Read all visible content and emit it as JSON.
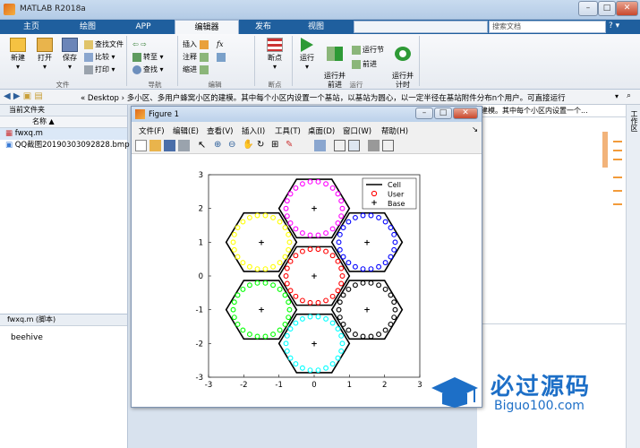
{
  "app": {
    "title": "MATLAB R2018a"
  },
  "tabs": [
    "主页",
    "绘图",
    "APP",
    "编辑器",
    "发布",
    "视图"
  ],
  "active_tab": "编辑器",
  "search": {
    "placeholder": "搜索文档"
  },
  "ribbon": {
    "file": {
      "new": "新建",
      "open": "打开",
      "save": "保存",
      "find_files": "查找文件",
      "compare": "比较",
      "print": "打印",
      "group": "文件"
    },
    "nav": {
      "goto": "转至",
      "find": "查找",
      "group": "导航"
    },
    "edit": {
      "insert": "插入",
      "comment": "注释",
      "indent": "缩进",
      "fx": "fx",
      "group": "编辑"
    },
    "breakpoints": {
      "label": "断点",
      "group": "断点"
    },
    "run": {
      "run": "运行",
      "run_advance": "运行并\n前进",
      "run_section": "运行节",
      "advance": "前进",
      "run_time": "运行并\n计时",
      "group": "运行"
    }
  },
  "address": {
    "path": "« Desktop › 多小区、多用户蜂窝小区的建模。其中每个小区内设置一个基站，以基站为圆心，以一定半径在基站附件分布n个用户。可直接运行"
  },
  "left_panel": {
    "header": "当前文件夹",
    "column": "名称 ▲",
    "files": [
      "fwxq.m",
      "QQ截图20190303092828.bmp"
    ],
    "detail_title": "fwxq.m  (脚本)",
    "detail_text": "beehive"
  },
  "right_panel": {
    "text": "建模。其中每个小区内设置一个...",
    "side_label": "工作区"
  },
  "figure": {
    "title": "Figure 1",
    "menu": [
      "文件(F)",
      "编辑(E)",
      "查看(V)",
      "插入(I)",
      "工具(T)",
      "桌面(D)",
      "窗口(W)",
      "帮助(H)"
    ]
  },
  "watermark": {
    "brand": "必过源码",
    "url": "Biguo100.com"
  },
  "chart_data": {
    "type": "scatter",
    "xlim": [
      -3,
      3
    ],
    "ylim": [
      -3,
      3
    ],
    "x_ticks": [
      -3,
      -2,
      -1,
      0,
      1,
      2,
      3
    ],
    "y_ticks": [
      -3,
      -2,
      -1,
      0,
      1,
      2,
      3
    ],
    "grid": false,
    "legend": {
      "placement": "top-right",
      "entries": [
        "Cell",
        "User",
        "Base"
      ]
    },
    "cell_radius": 1,
    "user_radius": 0.8,
    "cells": [
      {
        "center": [
          0,
          0
        ],
        "color": "#ff0000"
      },
      {
        "center": [
          0,
          2
        ],
        "color": "#ff00ff"
      },
      {
        "center": [
          1.5,
          1
        ],
        "color": "#0000ff"
      },
      {
        "center": [
          -1.5,
          1
        ],
        "color": "#ffff00"
      },
      {
        "center": [
          -1.5,
          -1
        ],
        "color": "#00ff00"
      },
      {
        "center": [
          1.5,
          -1
        ],
        "color": "#000000"
      },
      {
        "center": [
          0,
          -2
        ],
        "color": "#00ffff"
      }
    ]
  }
}
